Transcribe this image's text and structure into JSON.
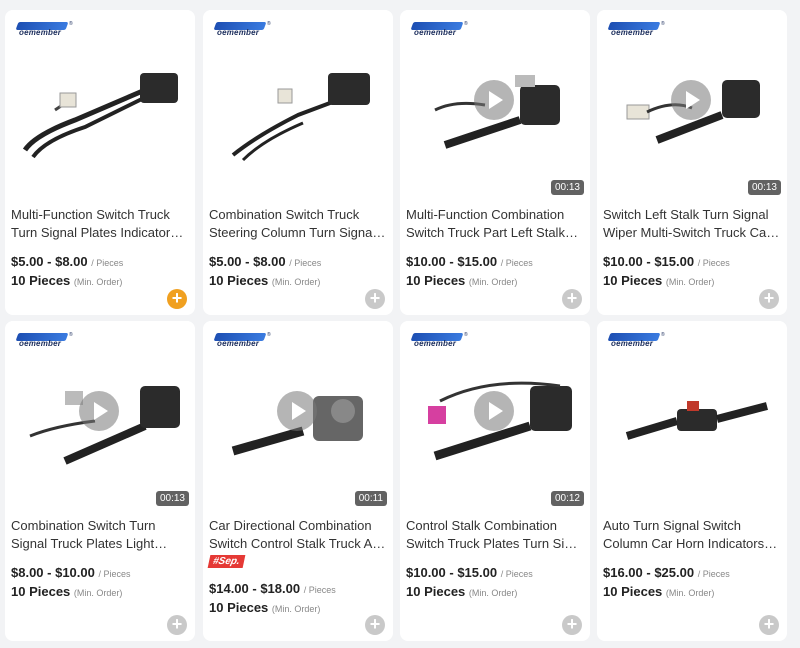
{
  "brand": {
    "logo_text": "oemember"
  },
  "products": [
    {
      "title1": "Multi-Function Switch Truck",
      "title2": "Turn Signal Plates Indicator…",
      "price": "$5.00 - $8.00",
      "unit": "/ Pieces",
      "moq": "10 Pieces",
      "moq_sub": "(Min. Order)",
      "duration": "",
      "play": false,
      "badge": "",
      "add_active": true
    },
    {
      "title1": "Combination Switch Truck",
      "title2": "Steering Column Turn Signal…",
      "price": "$5.00 - $8.00",
      "unit": "/ Pieces",
      "moq": "10 Pieces",
      "moq_sub": "(Min. Order)",
      "duration": "",
      "play": false,
      "badge": "",
      "add_active": false
    },
    {
      "title1": "Multi-Function Combination",
      "title2": "Switch Truck Part Left Stalk…",
      "price": "$10.00 - $15.00",
      "unit": "/ Pieces",
      "moq": "10 Pieces",
      "moq_sub": "(Min. Order)",
      "duration": "00:13",
      "play": true,
      "badge": "",
      "add_active": false
    },
    {
      "title1": "Switch Left Stalk Turn Signal",
      "title2": "Wiper Multi-Switch Truck Car…",
      "price": "$10.00 - $15.00",
      "unit": "/ Pieces",
      "moq": "10 Pieces",
      "moq_sub": "(Min. Order)",
      "duration": "00:13",
      "play": true,
      "badge": "",
      "add_active": false
    },
    {
      "title1": "Combination Switch Turn",
      "title2": "Signal Truck Plates Light…",
      "price": "$8.00 - $10.00",
      "unit": "/ Pieces",
      "moq": "10 Pieces",
      "moq_sub": "(Min. Order)",
      "duration": "00:13",
      "play": true,
      "badge": "",
      "add_active": false
    },
    {
      "title1": "Car Directional Combination",
      "title2": "Switch Control Stalk Truck Au…",
      "price": "$14.00 - $18.00",
      "unit": "/ Pieces",
      "moq": "10 Pieces",
      "moq_sub": "(Min. Order)",
      "duration": "00:11",
      "play": true,
      "badge": "#Sep.",
      "add_active": false
    },
    {
      "title1": "Control Stalk Combination",
      "title2": "Switch Truck Plates Turn Sign…",
      "price": "$10.00 - $15.00",
      "unit": "/ Pieces",
      "moq": "10 Pieces",
      "moq_sub": "(Min. Order)",
      "duration": "00:12",
      "play": true,
      "badge": "",
      "add_active": false
    },
    {
      "title1": "Auto Turn Signal Switch",
      "title2": "Column Car Horn Indicators…",
      "price": "$16.00 - $25.00",
      "unit": "/ Pieces",
      "moq": "10 Pieces",
      "moq_sub": "(Min. Order)",
      "duration": "",
      "play": false,
      "badge": "",
      "add_active": false
    }
  ],
  "colors": {
    "accent": "#f0a020",
    "badge": "#e53935"
  }
}
